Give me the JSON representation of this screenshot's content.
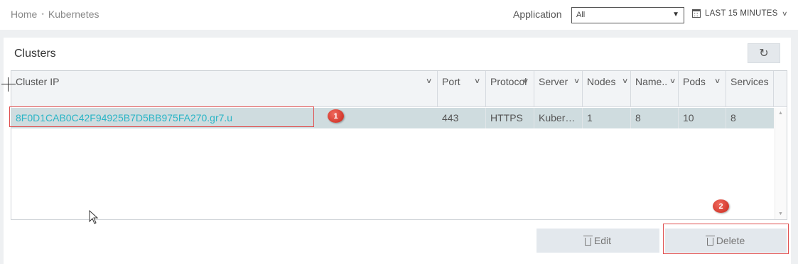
{
  "breadcrumb": {
    "home": "Home",
    "separator": "•",
    "current": "Kubernetes"
  },
  "filter": {
    "label": "Application",
    "selected": "All"
  },
  "time_range": {
    "label": "LAST 15 MINUTES"
  },
  "panel": {
    "title": "Clusters"
  },
  "table": {
    "columns": [
      "Cluster IP",
      "Port",
      "Protocol",
      "Server",
      "Nodes",
      "Name..",
      "Pods",
      "Services"
    ],
    "rows": [
      {
        "cluster_ip": "8F0D1CAB0C42F94925B7D5BB975FA270.gr7.u",
        "port": "443",
        "protocol": "HTTPS",
        "server": "Kuber…",
        "nodes": "1",
        "namespaces": "8",
        "pods": "10",
        "services": "8"
      }
    ]
  },
  "actions": {
    "edit": "Edit",
    "delete": "Delete"
  },
  "annotations": {
    "first": "1",
    "second": "2"
  },
  "colors": {
    "link": "#2bb5c6",
    "selected_row": "#cfdcdf",
    "annotation": "#e05050"
  }
}
